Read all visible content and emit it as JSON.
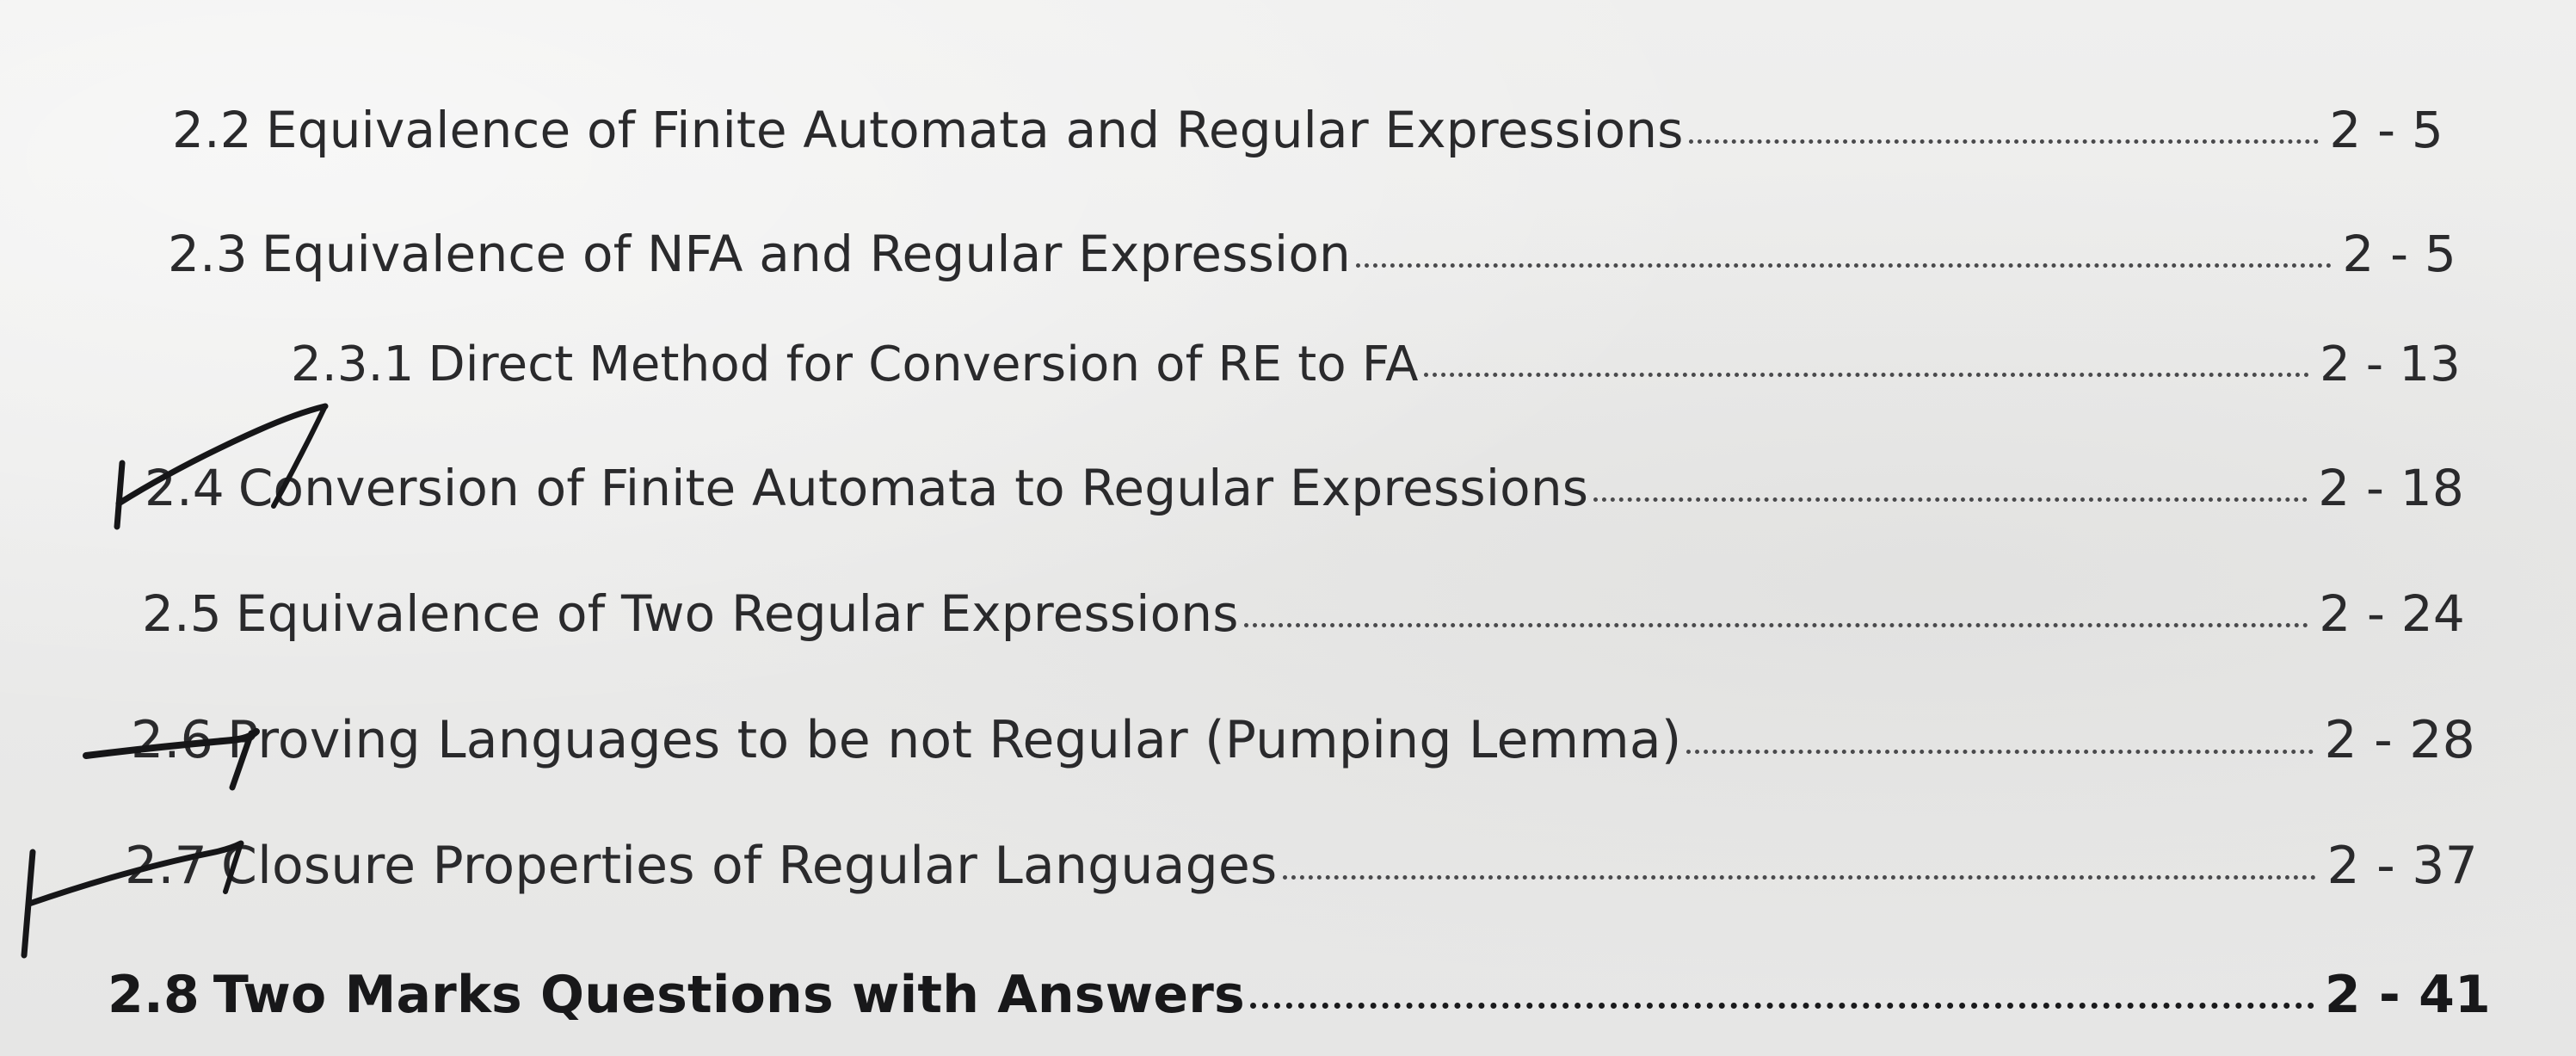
{
  "toc": {
    "entries": [
      {
        "number": "2.2",
        "title": "Equivalence of Finite Automata and Regular Expressions",
        "page": "2 - 5"
      },
      {
        "number": "2.3",
        "title": "Equivalence of NFA and Regular Expression",
        "page": "2 - 5"
      },
      {
        "number": "2.3.1",
        "title": "Direct Method for Conversion of RE to FA",
        "page": "2 - 13"
      },
      {
        "number": "2.4",
        "title": "Conversion of Finite Automata to Regular Expressions",
        "page": "2 - 18"
      },
      {
        "number": "2.5",
        "title": "Equivalence of Two Regular Expressions",
        "page": "2 - 24"
      },
      {
        "number": "2.6",
        "title": "Proving Languages to be not Regular (Pumping Lemma)",
        "page": "2 - 28"
      },
      {
        "number": "2.7",
        "title": "Closure Properties of Regular Languages",
        "page": "2 - 37"
      },
      {
        "number": "2.8",
        "title": "Two Marks Questions with Answers",
        "page": "2 - 41"
      }
    ]
  },
  "colors": {
    "paper": "#ebebea",
    "ink": "#2a2a2c",
    "pen": "#161618"
  }
}
